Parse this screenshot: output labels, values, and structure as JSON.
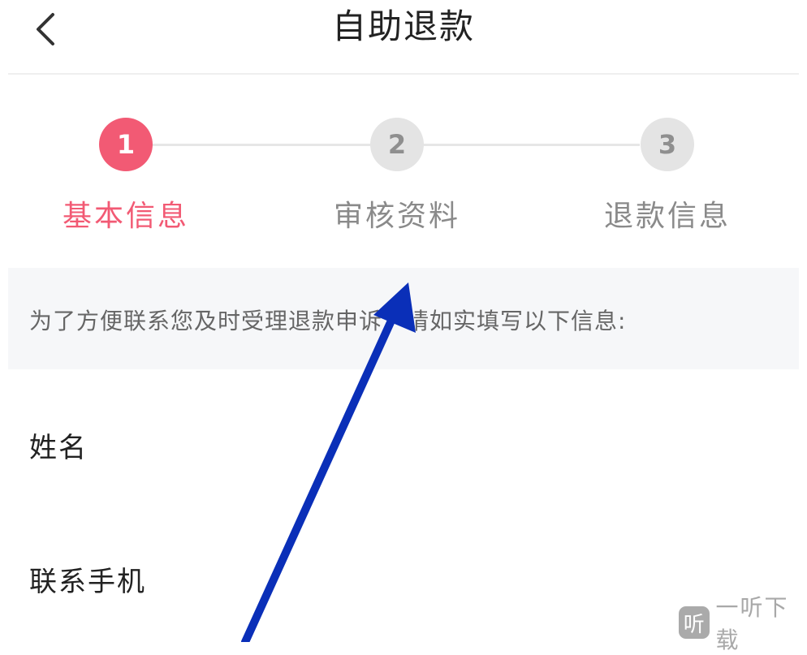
{
  "header": {
    "title": "自助退款",
    "back_icon": "chevron-left-icon"
  },
  "steps": {
    "items": [
      {
        "number": "1",
        "label": "基本信息",
        "state": "active"
      },
      {
        "number": "2",
        "label": "审核资料",
        "state": "inactive"
      },
      {
        "number": "3",
        "label": "退款信息",
        "state": "inactive"
      }
    ],
    "active_color": "#f25a74",
    "inactive_color": "#e4e4e4"
  },
  "notice": {
    "text": "为了方便联系您及时受理退款申诉，请如实填写以下信息:"
  },
  "form": {
    "name_label": "姓名",
    "phone_label": "联系手机"
  },
  "annotation": {
    "arrow_color": "#0a2fb8"
  },
  "watermark": {
    "logo_text": "听",
    "text": "一听下载"
  }
}
